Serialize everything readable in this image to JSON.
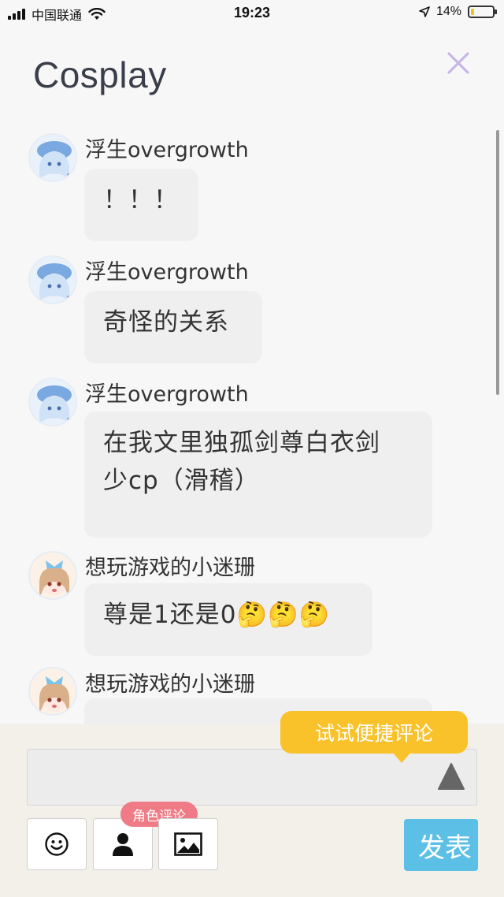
{
  "status_bar": {
    "carrier": "中国联通",
    "time": "19:23",
    "battery": "14%",
    "battery_level": 0.14,
    "icons": [
      "signal-icon",
      "wifi-icon",
      "location-icon",
      "battery-icon"
    ]
  },
  "header": {
    "title": "Cosplay",
    "close_icon": "close-icon"
  },
  "comments": [
    {
      "user": "浮生overgrowth",
      "text": "！！！"
    },
    {
      "user": "浮生overgrowth",
      "text": "奇怪的关系"
    },
    {
      "user": "浮生overgrowth",
      "line1": "在我文里独孤剑尊白衣剑",
      "line2": "少cp（滑稽）"
    },
    {
      "user": "想玩游戏的小迷珊",
      "text": "尊是1还是0🤔🤔🤔"
    },
    {
      "user": "想玩游戏的小迷珊"
    }
  ],
  "input": {
    "placeholder": "",
    "tooltip": "试试便捷评论",
    "role_badge": "角色评论",
    "send_label": "发表"
  },
  "colors": {
    "accent_send": "#5bbfe6",
    "tooltip": "#f9c22a",
    "role_badge": "#ef7b86",
    "close": "#c8b6e8"
  }
}
